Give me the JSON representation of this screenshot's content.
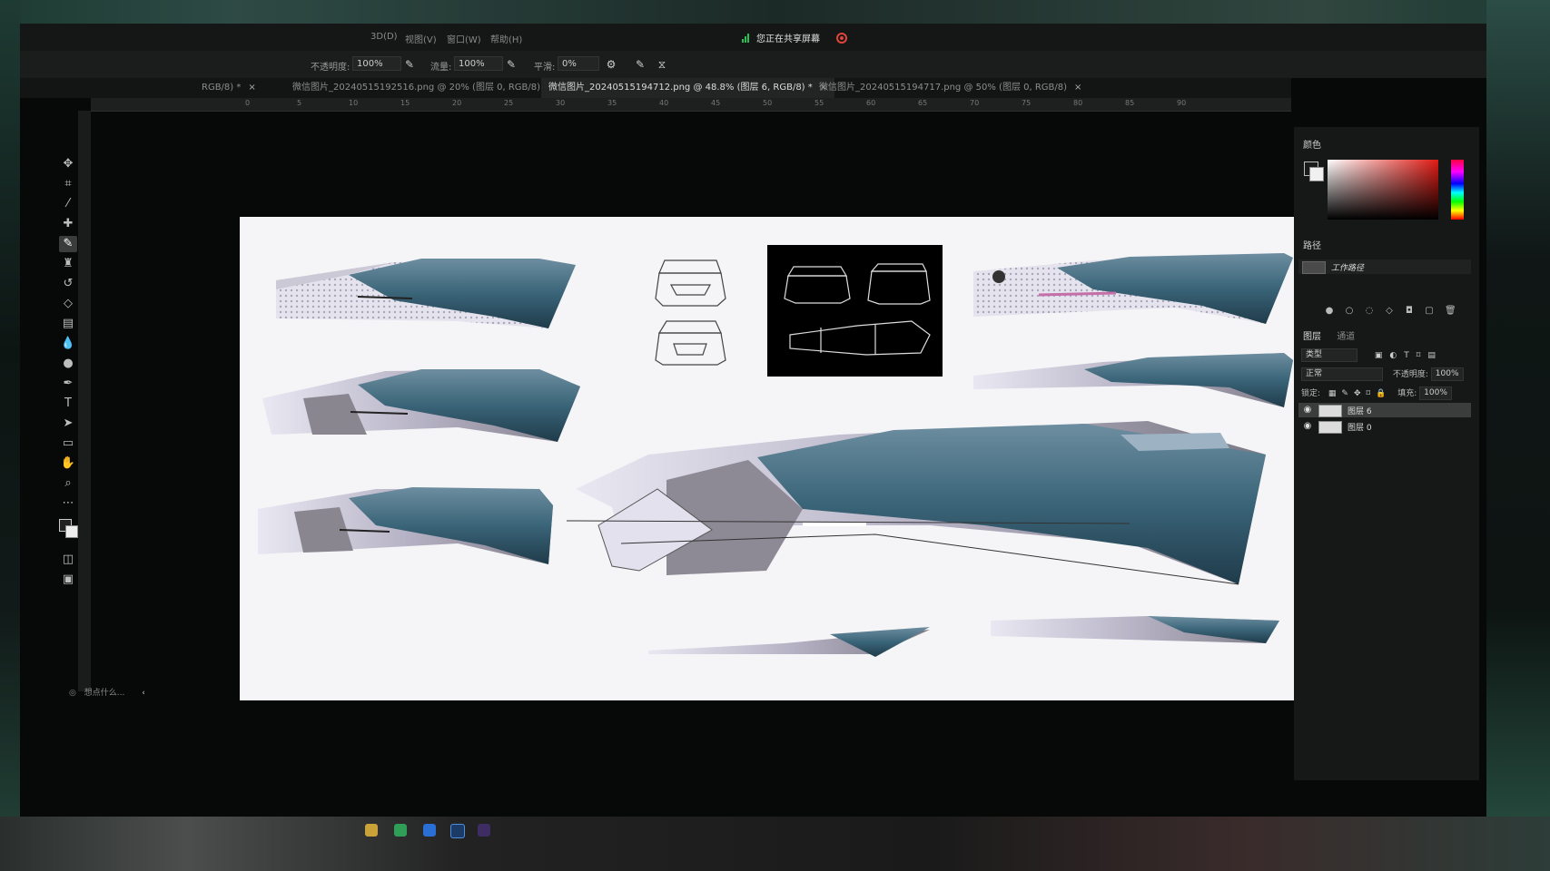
{
  "menubar": {
    "items": [
      "3D(D)",
      "视图(V)",
      "窗口(W)",
      "帮助(H)"
    ],
    "share_status": "您正在共享屏幕"
  },
  "options": {
    "opacity_label": "不透明度:",
    "opacity_value": "100%",
    "flow_label": "流量:",
    "flow_value": "100%",
    "smoothing_label": "平滑:",
    "smoothing_value": "0%"
  },
  "tabs": [
    {
      "label": "RGB/8) *",
      "close": "×"
    },
    {
      "label": "微信图片_20240515192516.png @ 20% (图层 0, RGB/8)",
      "close": "×"
    },
    {
      "label": "微信图片_20240515194712.png @ 48.8% (图层 6, RGB/8) *",
      "close": "×"
    },
    {
      "label": "微信图片_20240515194717.png @ 50% (图层 0, RGB/8)",
      "close": "×"
    }
  ],
  "ruler_marks": [
    "0",
    "5",
    "10",
    "15",
    "20",
    "25",
    "30",
    "35",
    "40",
    "45",
    "50",
    "55",
    "60",
    "65",
    "70",
    "75",
    "80",
    "85",
    "90"
  ],
  "panels": {
    "color_title": "颜色",
    "paths_title": "路径",
    "work_path": "工作路径",
    "layers_tab": "图层",
    "channels_tab": "通道",
    "filter_label": "类型",
    "blend_mode": "正常",
    "opacity_label": "不透明度:",
    "opacity_value": "100%",
    "lock_label": "锁定:",
    "fill_label": "填充:",
    "fill_value": "100%",
    "layers": [
      {
        "name": "图层 6",
        "selected": true
      },
      {
        "name": "图层 0",
        "selected": false
      }
    ]
  },
  "status": {
    "search_text": "想点什么..."
  },
  "colors": {
    "accent_green": "#2bbf5a",
    "record_red": "#e0453a",
    "car_blue": "#3a6478"
  }
}
